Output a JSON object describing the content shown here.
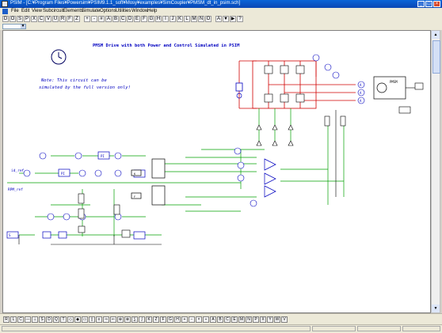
{
  "window": {
    "title": "PSIM - [C:¥Program Files¥Powersim¥PSIM9.1.1_soft¥Mosy¥examples¥SimCoupler¥PMSM_dt_in_psim.sch]",
    "min_glyph": "_",
    "max_glyph": "□",
    "close_glyph": "×"
  },
  "menu": [
    "File",
    "Edit",
    "View",
    "Subcircuit",
    "Elements",
    "Simulate",
    "Options",
    "Utilities",
    "Window",
    "Help"
  ],
  "toolbar": {
    "buttons": [
      "D",
      "O",
      "S",
      "P",
      "X",
      "C",
      "V",
      "U",
      "R",
      "F",
      "Z",
      "+",
      "-",
      "#",
      "A",
      "B",
      "C",
      "D",
      "E",
      "F",
      "G",
      "H",
      "I",
      "J",
      "K",
      "L",
      "M",
      "N",
      "O",
      "A",
      "▼",
      "▶",
      "?"
    ]
  },
  "schematic": {
    "title": "PMSM Drive with both Power and Control Simulated in PSIM",
    "note_line1": "Note: This circuit can be",
    "note_line2": "simulated by the full version only!",
    "labels": {
      "id_ref": "id_ref",
      "rpm_ref": "RPM_ref",
      "iq": "Iq",
      "pmsm": "PMSM",
      "pi": "PI",
      "a": "A",
      "v": "V",
      "k": "K",
      "s": "S",
      "f": "F"
    }
  },
  "element_bar": {
    "buttons": [
      "R",
      "L",
      "C",
      "—",
      "⊥",
      "S",
      "D",
      "Q",
      "T",
      "◇",
      "◆",
      "▭",
      "▯",
      "≡",
      "⇒",
      "⇐",
      "⊕",
      "⊗",
      "∑",
      "∫",
      "K",
      "Z",
      "F",
      "G",
      "H",
      "+",
      "−",
      "×",
      "÷",
      "A",
      "B",
      "C",
      "E",
      "M",
      "N",
      "P",
      "X",
      "Y",
      "W",
      "V"
    ]
  },
  "colors": {
    "wire_green": "#00a000",
    "wire_red": "#d00000",
    "wire_black": "#000000",
    "element_blue": "#0000d0",
    "title_blue": "#0000c0",
    "titlebar": "#0a5ad0"
  }
}
